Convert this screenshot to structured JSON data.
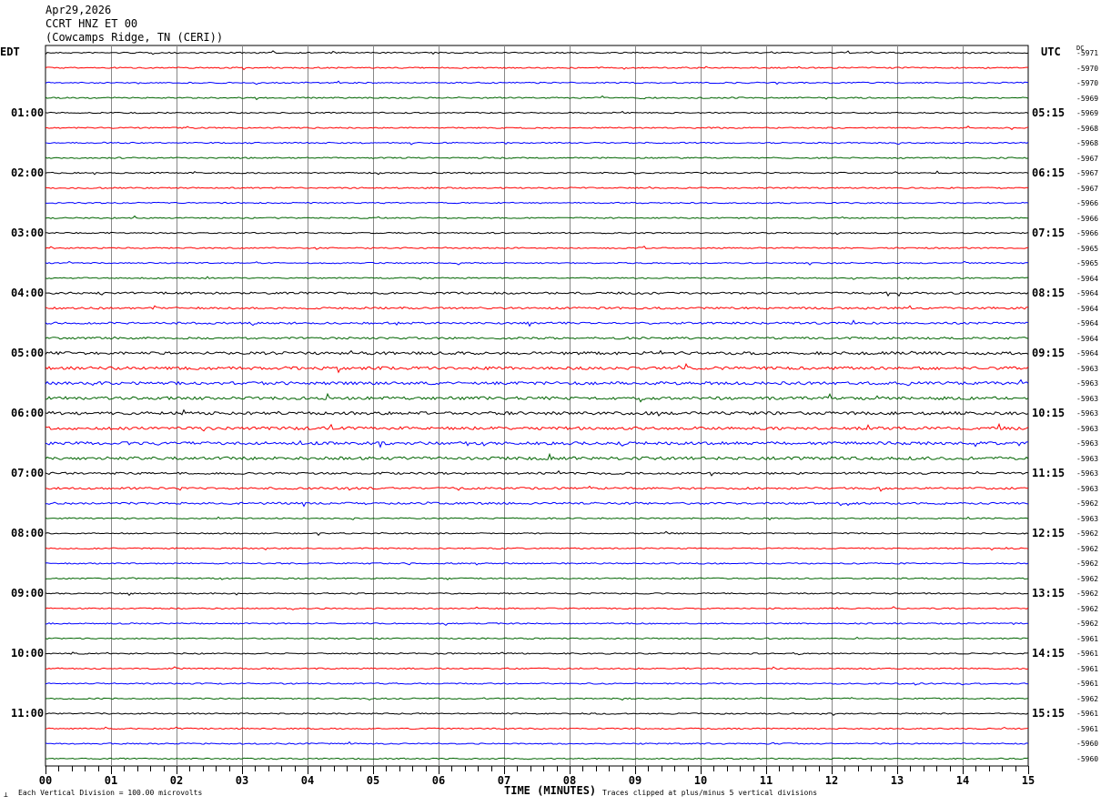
{
  "header": {
    "date": "Apr29,2026",
    "station": "CCRT HNZ ET 00",
    "location": "(Cowcamps Ridge, TN (CERI))"
  },
  "left_tz": "EDT",
  "right_tz": "UTC",
  "dc_label": "DC",
  "footer": {
    "scale_note": "Each Vertical Division =  100.00 microvolts",
    "xlabel": "TIME (MINUTES)",
    "clip_note": "Traces clipped at plus/minus 5 vertical divisions"
  },
  "chart_data": {
    "type": "line",
    "title": "CCRT HNZ ET 00 helicorder",
    "xlabel": "TIME (MINUTES)",
    "xlim": [
      0,
      15
    ],
    "x_ticks": [
      "00",
      "01",
      "02",
      "03",
      "04",
      "05",
      "06",
      "07",
      "08",
      "09",
      "10",
      "11",
      "12",
      "13",
      "14",
      "15"
    ],
    "trace_count": 48,
    "minutes_per_trace": 15,
    "trace_colors": [
      "#000000",
      "#ff0000",
      "#0000ff",
      "#006400"
    ],
    "left_hour_labels": [
      "",
      "01:00",
      "02:00",
      "03:00",
      "04:00",
      "05:00",
      "06:00",
      "07:00",
      "08:00",
      "09:00",
      "10:00",
      "11:00"
    ],
    "right_hour_labels": [
      "",
      "05:15",
      "06:15",
      "07:15",
      "08:15",
      "09:15",
      "10:15",
      "11:15",
      "12:15",
      "13:15",
      "14:15",
      "15:15"
    ],
    "dc_offsets": [
      -5971,
      -5970,
      -5970,
      -5969,
      -5969,
      -5968,
      -5968,
      -5967,
      -5967,
      -5967,
      -5966,
      -5966,
      -5966,
      -5965,
      -5965,
      -5964,
      -5964,
      -5964,
      -5964,
      -5964,
      -5964,
      -5963,
      -5963,
      -5963,
      -5963,
      -5963,
      -5963,
      -5963,
      -5963,
      -5963,
      -5962,
      -5963,
      -5962,
      -5962,
      -5962,
      -5962,
      -5962,
      -5962,
      -5962,
      -5961,
      -5961,
      -5961,
      -5961,
      -5962,
      -5961,
      -5961,
      -5960,
      -5960
    ],
    "units": "100.00 microvolts per vertical division"
  }
}
